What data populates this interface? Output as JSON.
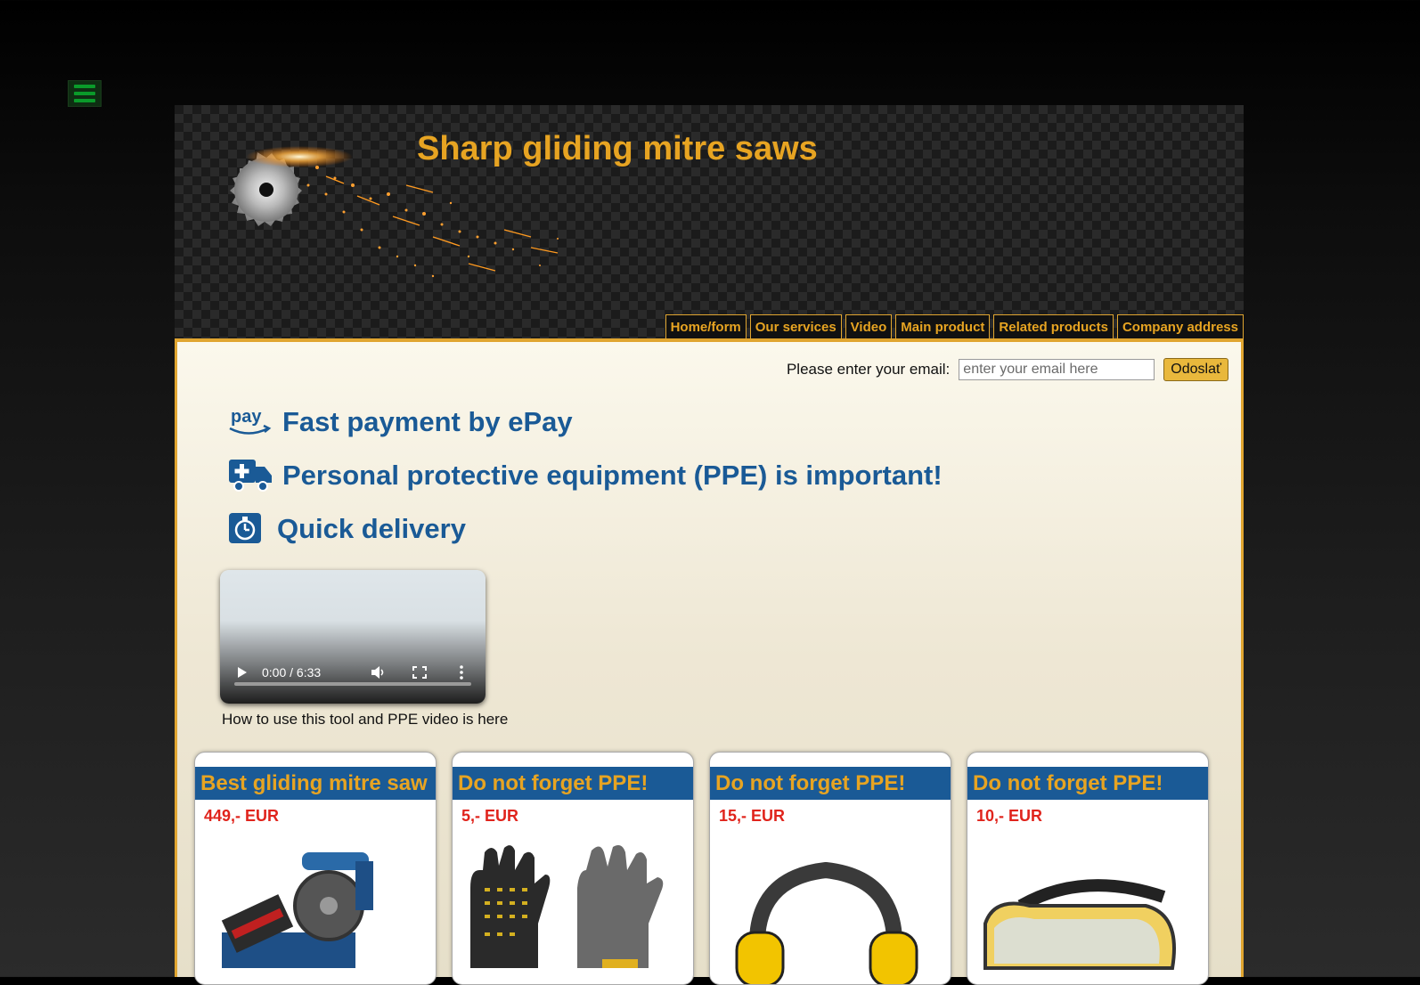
{
  "header": {
    "title": "Sharp gliding mitre saws",
    "nav": [
      "Home/form",
      "Our services",
      "Video",
      "Main product",
      "Related products",
      "Company address"
    ]
  },
  "menu_toggle_icon": "hamburger-menu-icon",
  "form": {
    "label": "Please enter your email:",
    "placeholder": "enter your email here",
    "submit": "Odoslať"
  },
  "features": [
    {
      "icon": "amazon-pay-icon",
      "text": "Fast payment by ePay"
    },
    {
      "icon": "ambulance-icon",
      "text": "Personal protective equipment (PPE) is important!"
    },
    {
      "icon": "stopwatch-icon",
      "text": "Quick delivery"
    }
  ],
  "video": {
    "time": "0:00 / 6:33",
    "caption": "How to use this tool and PPE video is here"
  },
  "products": [
    {
      "title": "Best gliding mitre saw",
      "price": "449,- EUR",
      "image": "mitre-saw"
    },
    {
      "title": "Do not forget PPE!",
      "price": "5,- EUR",
      "image": "work-gloves"
    },
    {
      "title": "Do not forget PPE!",
      "price": "15,- EUR",
      "image": "ear-muffs"
    },
    {
      "title": "Do not forget PPE!",
      "price": "10,- EUR",
      "image": "safety-goggles"
    }
  ],
  "colors": {
    "accent_gold": "#e7a422",
    "brand_blue": "#1a5a96",
    "price_red": "#e0241c",
    "menu_green": "#0a9a2a"
  }
}
